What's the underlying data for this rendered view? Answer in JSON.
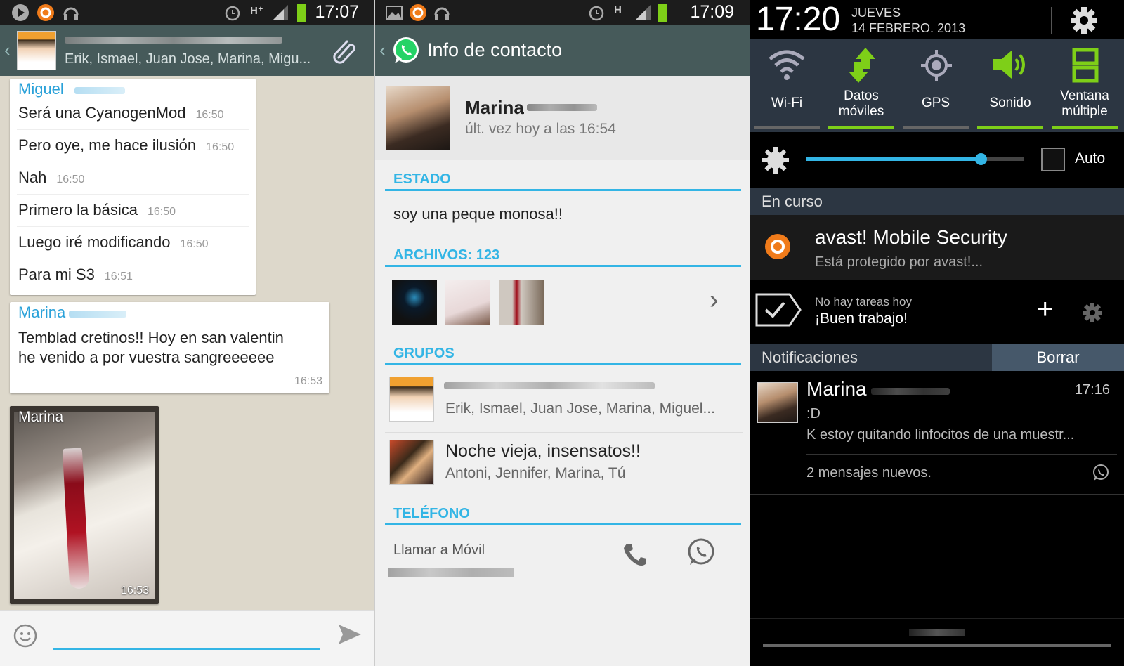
{
  "panel1": {
    "status_time": "17:07",
    "group_members": "Erik, Ismael, Juan Jose, Marina, Migu...",
    "messages_miguel": {
      "sender": "Miguel",
      "items": [
        {
          "text": "Será una CyanogenMod",
          "time": "16:50"
        },
        {
          "text": "Pero oye, me hace ilusión",
          "time": "16:50"
        },
        {
          "text": "Nah",
          "time": "16:50"
        },
        {
          "text": "Primero la básica",
          "time": "16:50"
        },
        {
          "text": "Luego iré modificando",
          "time": "16:50"
        },
        {
          "text": "Para mi S3",
          "time": "16:51"
        }
      ]
    },
    "message_marina": {
      "sender": "Marina",
      "line1": "Temblad cretinos!! Hoy en san valentin",
      "line2": "he venido a por vuestra sangreeeeee",
      "time": "16:53"
    },
    "image_message": {
      "sender": "Marina",
      "time": "16:53"
    }
  },
  "panel2": {
    "status_time": "17:09",
    "title": "Info de contacto",
    "contact_name": "Marina",
    "last_seen": "últ. vez hoy a las 16:54",
    "estado_head": "ESTADO",
    "estado_text": "soy una peque monosa!!",
    "archivos_head": "ARCHIVOS: 123",
    "grupos_head": "GRUPOS",
    "groups": [
      {
        "members": "Erik, Ismael, Juan Jose, Marina, Miguel..."
      },
      {
        "name": "Noche vieja, insensatos!!",
        "members": "Antoni, Jennifer, Marina, Tú"
      }
    ],
    "telefono_head": "TELÉFONO",
    "call_label": "Llamar a Móvil"
  },
  "panel3": {
    "time": "17:20",
    "day": "JUEVES",
    "date": "14 FEBRERO. 2013",
    "toggles": [
      {
        "label": "Wi-Fi",
        "active": false
      },
      {
        "label": "Datos\nmóviles",
        "active": true
      },
      {
        "label": "GPS",
        "active": false
      },
      {
        "label": "Sonido",
        "active": true
      },
      {
        "label": "Ventana\nmúltiple",
        "active": true
      }
    ],
    "brightness_level": 0.8,
    "auto_label": "Auto",
    "ongoing_head": "En curso",
    "avast_title": "avast! Mobile Security",
    "avast_sub": "Está protegido por avast!...",
    "tasks_line1": "No hay tareas hoy",
    "tasks_line2": "¡Buen trabajo!",
    "notif_head": "Notificaciones",
    "clear_label": "Borrar",
    "notif_name": "Marina",
    "notif_time": "17:16",
    "notif_line1": ":D",
    "notif_line2": "K estoy quitando linfocitos de una muestr...",
    "notif_count": "2 mensajes nuevos."
  },
  "colors": {
    "accent": "#33b5e5",
    "whatsapp_green": "#25d366",
    "toggle_on": "#7ecf18",
    "actionbar": "#465a5a"
  }
}
